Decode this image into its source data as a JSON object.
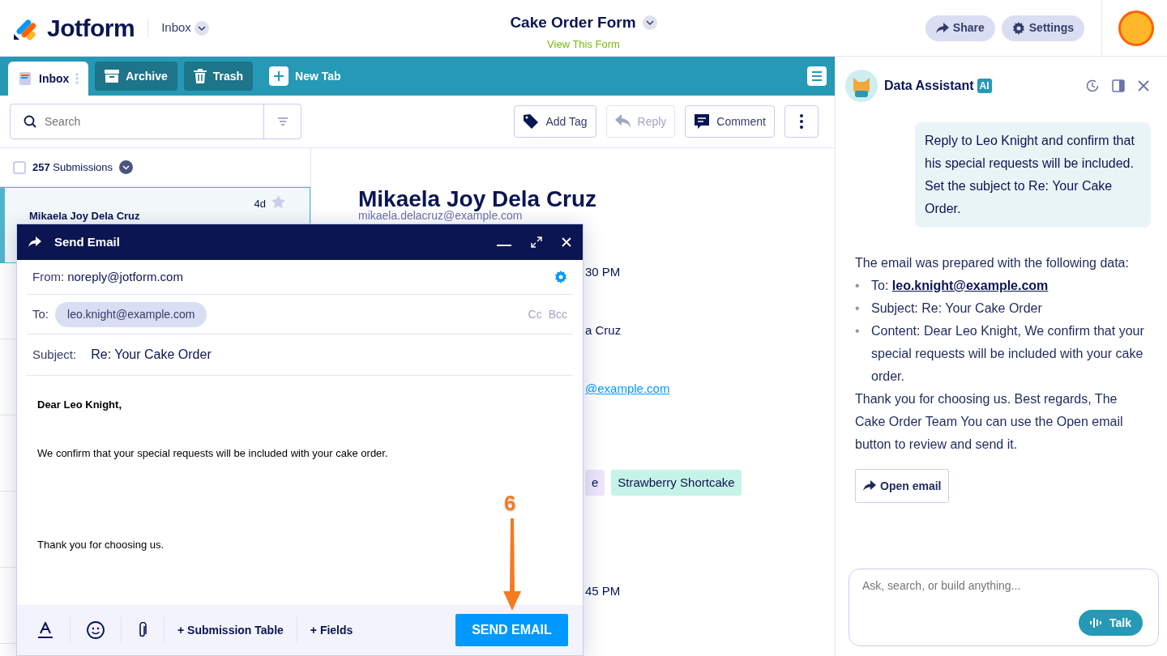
{
  "header": {
    "logo": "Jotform",
    "inbox_menu": "Inbox",
    "form_title": "Cake Order Form",
    "form_link": "View This Form",
    "buttons": [
      "Share",
      "Settings"
    ]
  },
  "tabs": [
    {
      "label": "Inbox",
      "selected": true
    },
    {
      "label": "Archive",
      "selected": false
    },
    {
      "label": "Trash",
      "selected": false
    }
  ],
  "new_tab": "New Tab",
  "search": {
    "placeholder": "Search"
  },
  "toolbar": [
    {
      "label": "Add Tag",
      "disabled": false
    },
    {
      "label": "Reply",
      "disabled": true
    },
    {
      "label": "Comment",
      "disabled": false
    }
  ],
  "submissions": {
    "count": "257",
    "label": "Submissions",
    "checked": false
  },
  "list": [
    {
      "name": "Mikaela Joy Dela Cruz",
      "age": "4d",
      "selected": true
    }
  ],
  "detail": {
    "name": "Mikaela Joy Dela Cruz",
    "email": "mikaela.delacruz@example.com",
    "rows": [
      {
        "kind": "text",
        "text": "30 PM"
      },
      {
        "kind": "text",
        "text": "a Cruz"
      },
      {
        "kind": "link",
        "text": "@example.com"
      },
      {
        "kind": "tags",
        "tags": [
          {
            "label": "e",
            "color": "#ece6fb"
          },
          {
            "label": "Strawberry Shortcake",
            "color": "#c6f3e7"
          }
        ]
      },
      {
        "kind": "text",
        "text": "45 PM"
      }
    ]
  },
  "send_email": {
    "title": "Send Email",
    "from_label": "From:",
    "from": "noreply@jotform.com",
    "to_label": "To:",
    "to": "leo.knight@example.com",
    "cc": "Cc",
    "bcc": "Bcc",
    "subject_label": "Subject:",
    "subject": "Re: Your Cake Order",
    "body": [
      {
        "text": "Dear Leo Knight,",
        "bold": true
      },
      {
        "text": "We confirm that your special requests will be included with your cake order.",
        "bold": false
      },
      {
        "text": "Thank you for choosing us.",
        "bold": false
      }
    ],
    "footer_links": [
      "+ Submission Table",
      "+ Fields"
    ],
    "send_button": "SEND EMAIL"
  },
  "assistant": {
    "title": "Data Assistant",
    "badge": "AI",
    "user_message": "Reply to Leo Knight and confirm that his special requests will be included. Set the subject to Re: Your Cake Order.",
    "reply_intro": "The email was prepared with the following data:",
    "reply_items": [
      {
        "kind": "link",
        "bullet": "•",
        "label": "To:",
        "value": "leo.knight@example.com"
      },
      {
        "kind": "text",
        "bullet": "•",
        "text": "Subject: Re: Your Cake Order"
      },
      {
        "kind": "text",
        "bullet": "•",
        "text": "Content: Dear Leo Knight, We confirm that your special requests will be included with your cake order."
      }
    ],
    "reply_outro": "Thank you for choosing us. Best regards, The Cake Order Team You can use the Open email button to review and send it.",
    "open_email_button": "Open email",
    "input": {
      "placeholder": "Ask, search, or build anything..."
    },
    "talk_button": "Talk"
  },
  "annotation": {
    "label": "6"
  }
}
